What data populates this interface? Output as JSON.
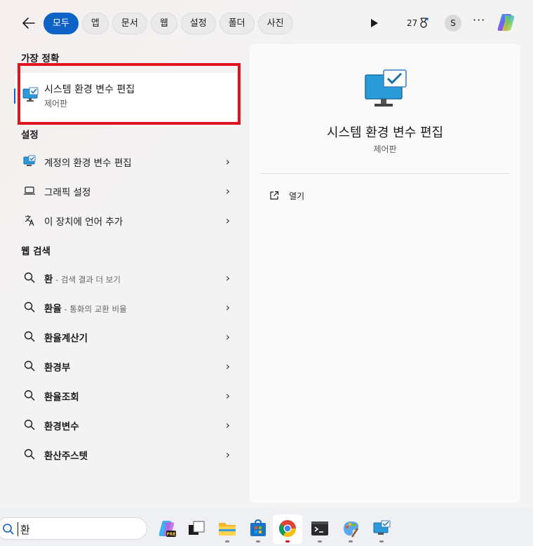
{
  "topbar": {
    "filters": [
      "모두",
      "앱",
      "문서",
      "웹",
      "설정",
      "폴더",
      "사진"
    ],
    "active_filter": "모두",
    "points": "27",
    "avatar_initial": "S",
    "more": "···"
  },
  "left": {
    "best_match_header": "가장 정확",
    "best_match": {
      "title": "시스템 환경 변수 편집",
      "subtitle": "제어판"
    },
    "settings_header": "설정",
    "settings_items": [
      "계정의 환경 변수 편집",
      "그래픽 설정",
      "이 장치에 언어 추가"
    ],
    "web_header": "웹 검색",
    "web_items": [
      {
        "bold": "환",
        "suffix": " - 검색 결과 더 보기"
      },
      {
        "bold": "환율",
        "suffix": " - 통화의 교환 비율"
      },
      {
        "bold": "환율계산기",
        "suffix": ""
      },
      {
        "bold": "환경부",
        "suffix": ""
      },
      {
        "bold": "환율조회",
        "suffix": ""
      },
      {
        "bold": "환경변수",
        "suffix": ""
      },
      {
        "bold": "환산주스텟",
        "suffix": ""
      }
    ]
  },
  "preview": {
    "title": "시스템 환경 변수 편집",
    "subtitle": "제어판",
    "action_open": "열기"
  },
  "taskbar": {
    "search_value": "환"
  },
  "colors": {
    "accent": "#0f63c7",
    "highlight_box": "#e0141e"
  }
}
